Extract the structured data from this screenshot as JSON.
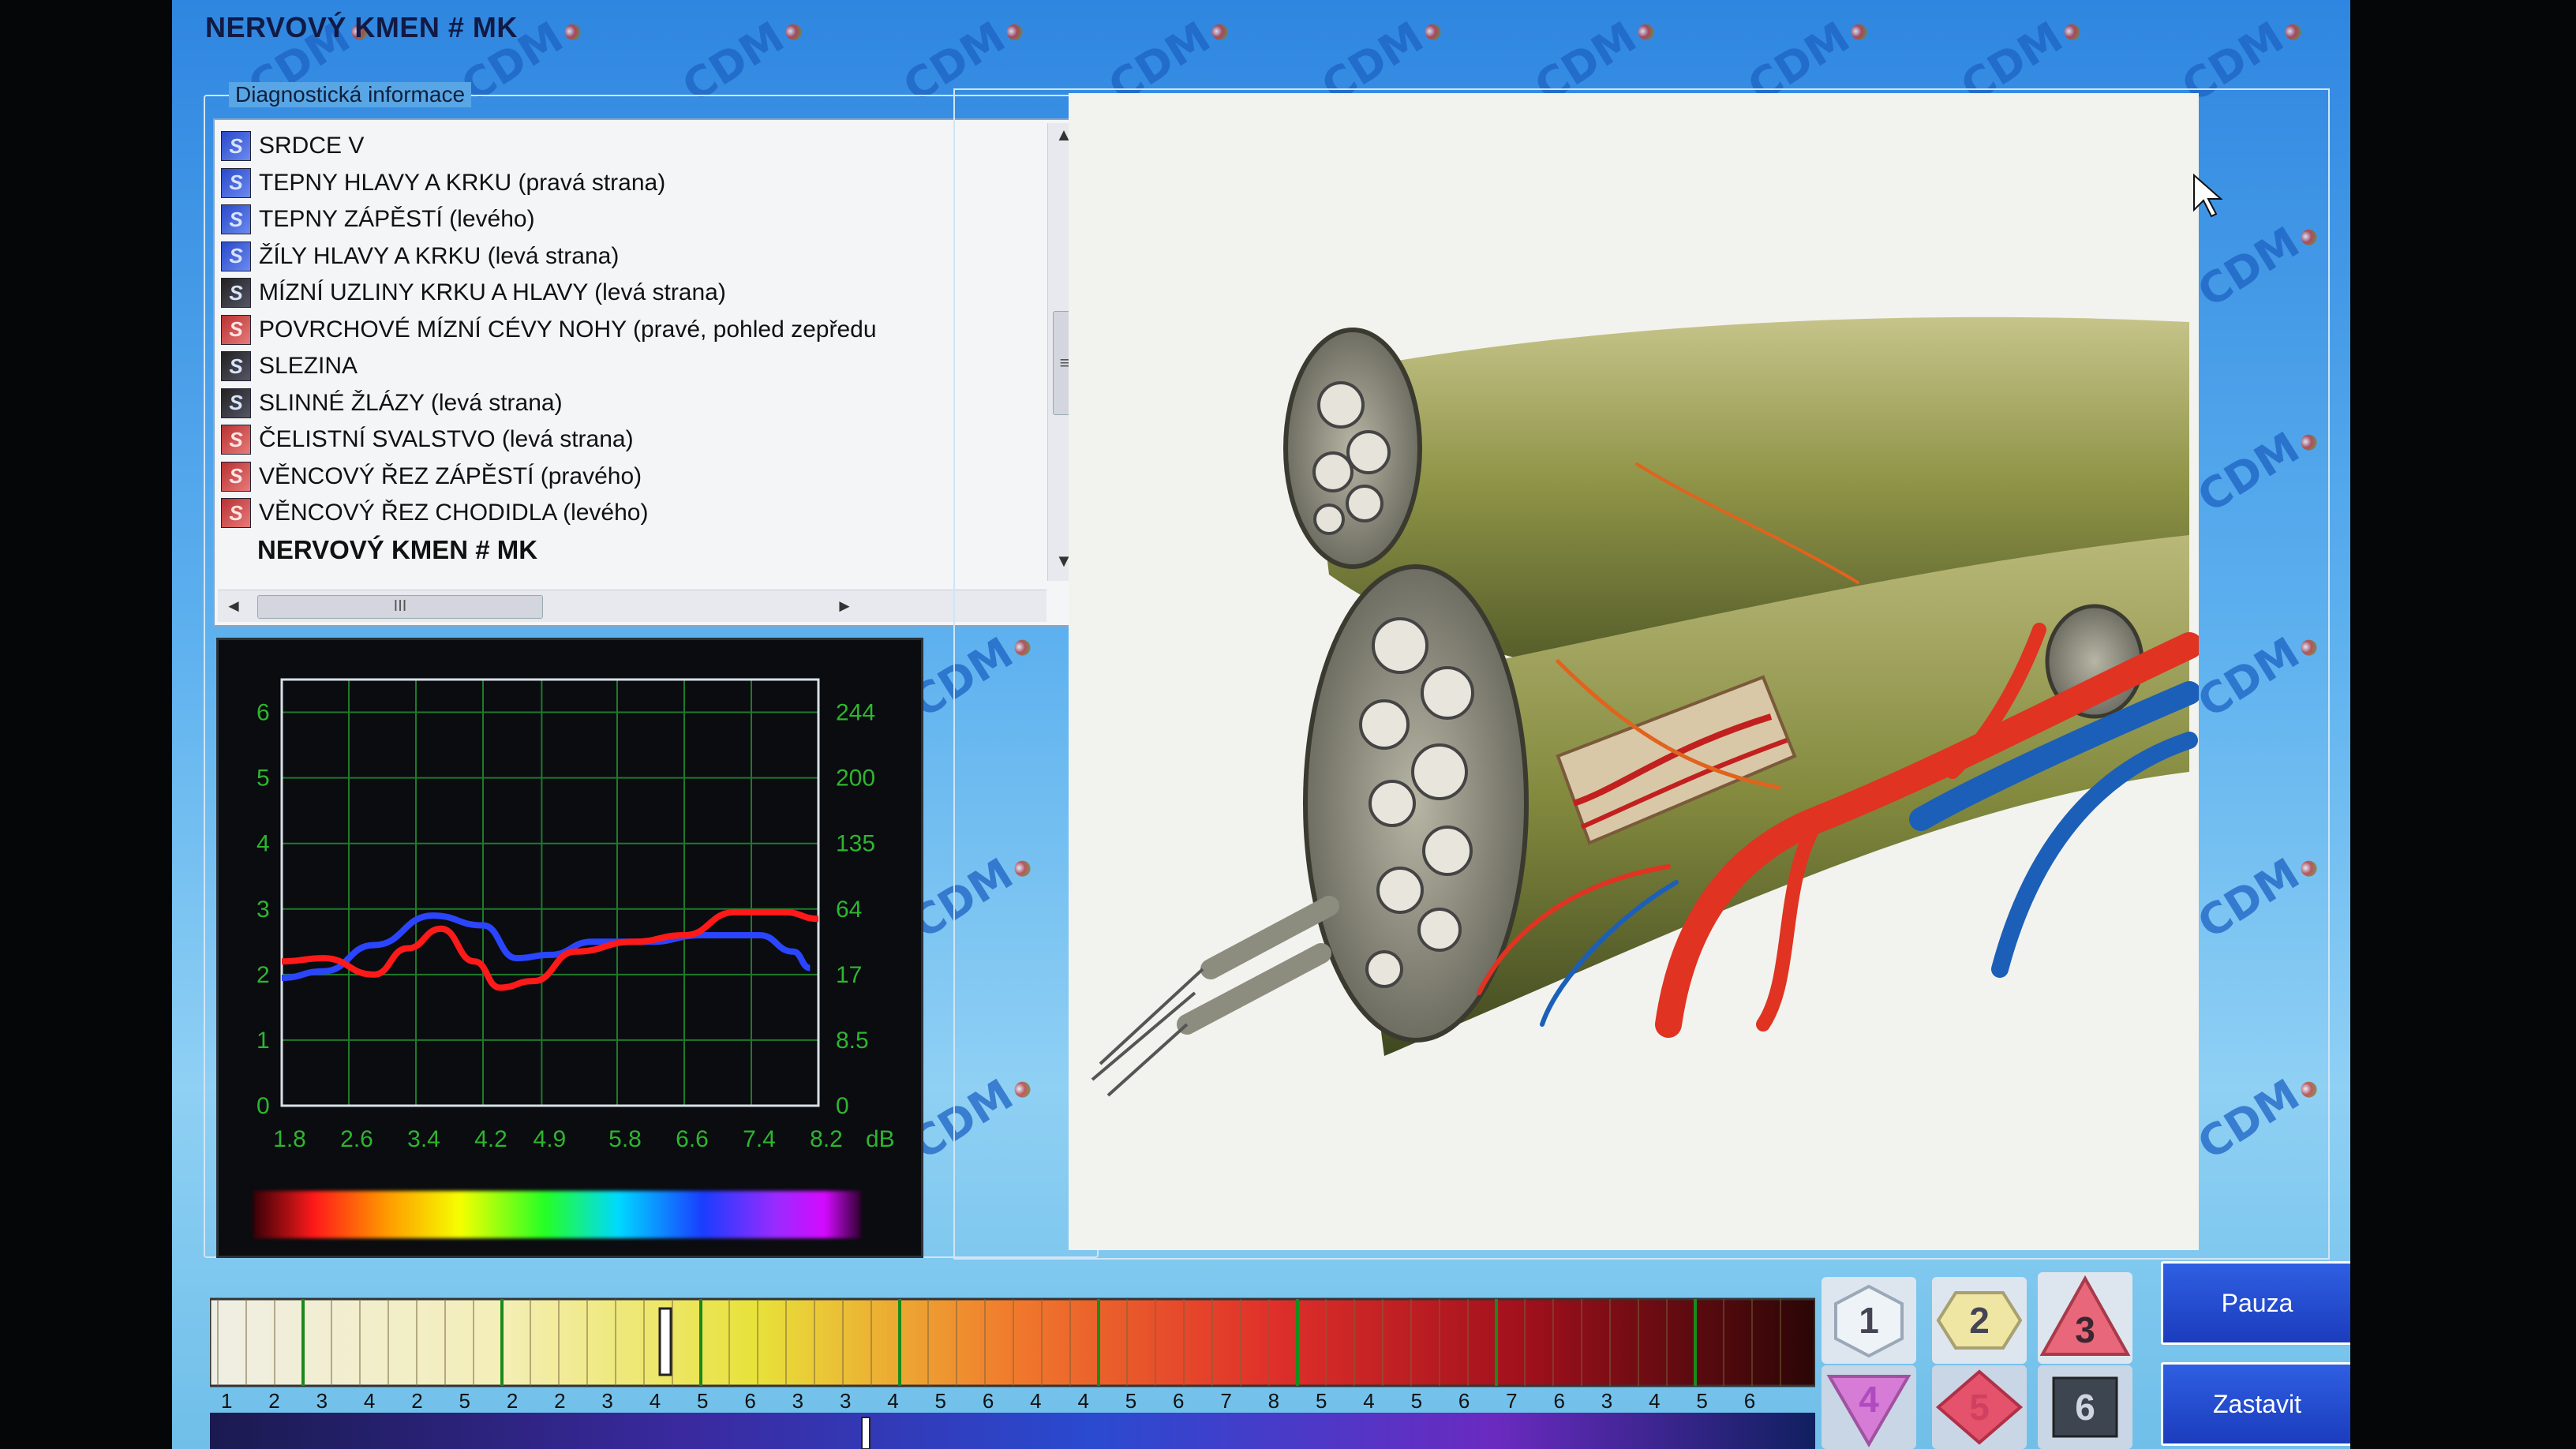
{
  "window": {
    "title": "NERVOVÝ KMEN # MK"
  },
  "diagnostic_group": {
    "label": "Diagnostická informace"
  },
  "list": {
    "items": [
      {
        "icon": "blue",
        "label": "SRDCE  V"
      },
      {
        "icon": "blue",
        "label": "TEPNY HLAVY A KRKU (pravá strana)"
      },
      {
        "icon": "blue",
        "label": "TEPNY ZÁPĚSTÍ (levého)"
      },
      {
        "icon": "blue",
        "label": "ŽÍLY HLAVY A KRKU (levá strana)"
      },
      {
        "icon": "dark",
        "label": "MÍZNÍ UZLINY KRKU A HLAVY (levá strana)"
      },
      {
        "icon": "red",
        "label": "POVRCHOVÉ MÍZNÍ CÉVY NOHY (pravé, pohled zepředu"
      },
      {
        "icon": "dark",
        "label": "SLEZINA"
      },
      {
        "icon": "dark",
        "label": "SLINNÉ ŽLÁZY (levá strana)"
      },
      {
        "icon": "red",
        "label": "ČELISTNÍ SVALSTVO (levá strana)"
      },
      {
        "icon": "red",
        "label": "VĚNCOVÝ ŘEZ  ZÁPĚSTÍ (pravého)"
      },
      {
        "icon": "red",
        "label": "VĚNCOVÝ ŘEZ  CHODIDLA (levého)"
      },
      {
        "icon": "none",
        "label": "NERVOVÝ KMEN # MK",
        "selected": true
      }
    ],
    "icon_letter": "S",
    "scroll": {
      "up": "▲",
      "down": "▼",
      "left": "◄",
      "right": "►",
      "vgrip": "≡",
      "hgrip": "III"
    }
  },
  "chart_data": {
    "type": "line",
    "x": [
      1.8,
      2.6,
      3.4,
      4.2,
      4.9,
      5.8,
      6.6,
      7.4,
      8.2
    ],
    "x_tick_labels": [
      "1.8",
      "2.6",
      "3.4",
      "4.2",
      "4.9",
      "5.8",
      "6.6",
      "7.4",
      "8.2"
    ],
    "x_unit": "dB",
    "y_left_ticks": [
      0,
      1,
      2,
      3,
      4,
      5,
      6
    ],
    "y_right_ticks": [
      "0",
      "8.5",
      "17",
      "64",
      "135",
      "200",
      "244"
    ],
    "ylim": [
      0,
      6.5
    ],
    "grid": true,
    "series": [
      {
        "color": "#2b45ff",
        "points": [
          [
            1.8,
            1.95
          ],
          [
            2.3,
            2.05
          ],
          [
            2.9,
            2.45
          ],
          [
            3.6,
            2.9
          ],
          [
            4.2,
            2.75
          ],
          [
            4.6,
            2.25
          ],
          [
            5.0,
            2.3
          ],
          [
            5.5,
            2.5
          ],
          [
            6.2,
            2.5
          ],
          [
            6.8,
            2.6
          ],
          [
            7.5,
            2.6
          ],
          [
            7.9,
            2.35
          ],
          [
            8.1,
            2.1
          ]
        ]
      },
      {
        "color": "#ff1a1a",
        "points": [
          [
            1.8,
            2.2
          ],
          [
            2.3,
            2.25
          ],
          [
            2.9,
            2.0
          ],
          [
            3.3,
            2.4
          ],
          [
            3.7,
            2.7
          ],
          [
            4.1,
            2.2
          ],
          [
            4.4,
            1.8
          ],
          [
            4.8,
            1.9
          ],
          [
            5.3,
            2.35
          ],
          [
            6.0,
            2.5
          ],
          [
            6.6,
            2.6
          ],
          [
            7.2,
            2.95
          ],
          [
            7.8,
            2.95
          ],
          [
            8.2,
            2.85
          ]
        ]
      }
    ],
    "axis_color": "#2fb52f",
    "grid_color": "#1f7a2a"
  },
  "bottom_scale": {
    "labels": [
      "1",
      "2",
      "3",
      "4",
      "2",
      "5",
      "2",
      "2",
      "3",
      "4",
      "5",
      "6",
      "3",
      "3",
      "4",
      "5",
      "6",
      "4",
      "4",
      "5",
      "6",
      "7",
      "8",
      "5",
      "4",
      "5",
      "6",
      "7",
      "6",
      "3",
      "4",
      "5",
      "6"
    ]
  },
  "controls": {
    "buttons": [
      "1",
      "2",
      "3",
      "4",
      "5",
      "6"
    ],
    "pause_label": "Pauza",
    "stop_label": "Zastavit"
  },
  "watermark_text": "CDM",
  "colors": {
    "accent_blue": "#1f43c9",
    "screen_bg": "#4aa3ea"
  }
}
